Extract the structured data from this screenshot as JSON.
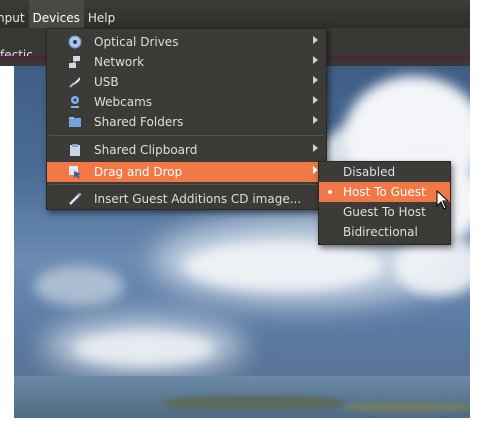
{
  "menubar": {
    "items": [
      {
        "label": "nput"
      },
      {
        "label": "Devices"
      },
      {
        "label": "Help"
      }
    ]
  },
  "window": {
    "title_fragment": "fectic"
  },
  "devices_menu": {
    "items": [
      {
        "label": "Optical Drives",
        "icon": "optical-disc-icon"
      },
      {
        "label": "Network",
        "icon": "network-icon"
      },
      {
        "label": "USB",
        "icon": "usb-icon"
      },
      {
        "label": "Webcams",
        "icon": "webcam-icon"
      },
      {
        "label": "Shared Folders",
        "icon": "folder-icon"
      },
      {
        "label": "Shared Clipboard",
        "icon": "clipboard-icon"
      },
      {
        "label": "Drag and Drop",
        "icon": "drag-drop-icon"
      },
      {
        "label": "Insert Guest Additions CD image...",
        "icon": "install-icon"
      }
    ]
  },
  "drag_drop_submenu": {
    "items": [
      {
        "label": "Disabled"
      },
      {
        "label": "Host To Guest",
        "selected": true
      },
      {
        "label": "Guest To Host"
      },
      {
        "label": "Bidirectional"
      }
    ]
  },
  "colors": {
    "highlight": "#f07746",
    "menu_bg": "#3c3b37"
  }
}
